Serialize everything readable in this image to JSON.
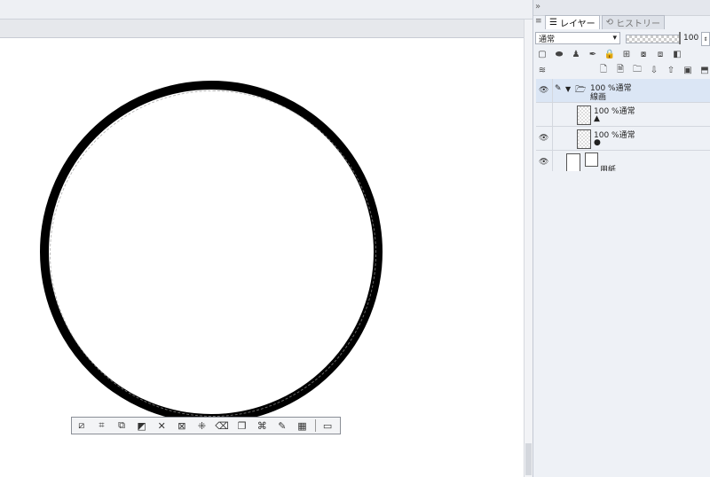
{
  "canvas": {
    "toolbar_icons": [
      "deselect-icon",
      "crop-icon",
      "invert-icon",
      "expand-icon",
      "shrink-icon",
      "transform-icon",
      "scale-icon",
      "clear-icon",
      "copy-paste-icon",
      "fill-icon",
      "free-transform-icon",
      "grid-icon",
      "settings-icon"
    ]
  },
  "panel": {
    "tabs": [
      {
        "label": "レイヤー",
        "active": true
      },
      {
        "label": "ヒストリー",
        "active": false
      }
    ],
    "blend_mode": "通常",
    "opacity_value": "100",
    "opacity_fraction": 1.0,
    "layers": [
      {
        "mode": "100 %通常",
        "name": "線画",
        "type": "folder"
      },
      {
        "mode": "100 %通常",
        "name": "▲",
        "type": "raster"
      },
      {
        "mode": "100 %通常",
        "name": "●",
        "type": "raster"
      },
      {
        "mode": "",
        "name": "用紙",
        "type": "paper"
      }
    ]
  }
}
